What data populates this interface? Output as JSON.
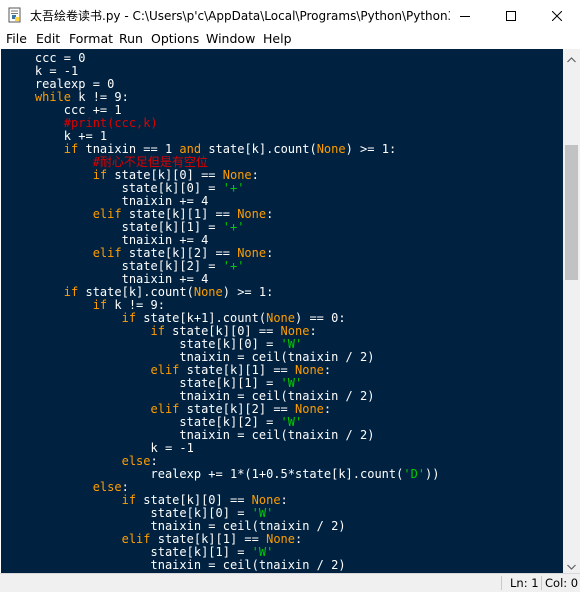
{
  "window": {
    "title": "太吾绘卷读书.py - C:\\Users\\p'c\\AppData\\Local\\Programs\\Python\\Python3...",
    "app_icon": "python-file-icon",
    "controls": [
      "minimize-icon",
      "maximize-icon",
      "close-icon"
    ]
  },
  "menu": [
    {
      "underline": "F",
      "rest": "ile"
    },
    {
      "underline": "E",
      "rest": "dit"
    },
    {
      "underline": "",
      "rest": "Format",
      "pre": "F",
      "prefix_ul": false
    },
    {
      "underline": "R",
      "rest": "un"
    },
    {
      "underline": "O",
      "rest": "ptions"
    },
    {
      "underline": "W",
      "rest": "indow"
    },
    {
      "underline": "H",
      "rest": "elp"
    }
  ],
  "menu_labels": [
    "File",
    "Edit",
    "Format",
    "Run",
    "Options",
    "Window",
    "Help"
  ],
  "colors": {
    "editor_bg": "#002240",
    "keyword": "#ff9d00",
    "comment": "#dd0000",
    "string": "#00cc00",
    "builtin": "#aa66ff",
    "default": "#ffffff"
  },
  "code_lines": [
    [
      {
        "t": "    ccc = 0"
      }
    ],
    [
      {
        "t": "    k = -1"
      }
    ],
    [
      {
        "t": "    realexp = 0"
      }
    ],
    [
      {
        "t": "    "
      },
      {
        "t": "while",
        "c": "kw"
      },
      {
        "t": " k != 9:"
      }
    ],
    [
      {
        "t": "        ccc += 1"
      }
    ],
    [
      {
        "t": "        "
      },
      {
        "t": "#print(ccc,k)",
        "c": "com"
      }
    ],
    [
      {
        "t": "        k += 1"
      }
    ],
    [
      {
        "t": "        "
      },
      {
        "t": "if",
        "c": "kw"
      },
      {
        "t": " tnaixin == 1 "
      },
      {
        "t": "and",
        "c": "kw"
      },
      {
        "t": " state[k].count("
      },
      {
        "t": "None",
        "c": "kw"
      },
      {
        "t": ") >= 1:"
      }
    ],
    [
      {
        "t": "            "
      },
      {
        "t": "#耐心不足但是有空位",
        "c": "com"
      }
    ],
    [
      {
        "t": "            "
      },
      {
        "t": "if",
        "c": "kw"
      },
      {
        "t": " state[k][0] == "
      },
      {
        "t": "None",
        "c": "kw"
      },
      {
        "t": ":"
      }
    ],
    [
      {
        "t": "                state[k][0] = "
      },
      {
        "t": "'+'",
        "c": "str"
      }
    ],
    [
      {
        "t": "                tnaixin += 4"
      }
    ],
    [
      {
        "t": "            "
      },
      {
        "t": "elif",
        "c": "kw"
      },
      {
        "t": " state[k][1] == "
      },
      {
        "t": "None",
        "c": "kw"
      },
      {
        "t": ":"
      }
    ],
    [
      {
        "t": "                state[k][1] = "
      },
      {
        "t": "'+'",
        "c": "str"
      }
    ],
    [
      {
        "t": "                tnaixin += 4"
      }
    ],
    [
      {
        "t": "            "
      },
      {
        "t": "elif",
        "c": "kw"
      },
      {
        "t": " state[k][2] == "
      },
      {
        "t": "None",
        "c": "kw"
      },
      {
        "t": ":"
      }
    ],
    [
      {
        "t": "                state[k][2] = "
      },
      {
        "t": "'+'",
        "c": "str"
      }
    ],
    [
      {
        "t": "                tnaixin += 4"
      }
    ],
    [
      {
        "t": "        "
      },
      {
        "t": "if",
        "c": "kw"
      },
      {
        "t": " state[k].count("
      },
      {
        "t": "None",
        "c": "kw"
      },
      {
        "t": ") >= 1:"
      }
    ],
    [
      {
        "t": "            "
      },
      {
        "t": "if",
        "c": "kw"
      },
      {
        "t": " k != 9:"
      }
    ],
    [
      {
        "t": "                "
      },
      {
        "t": "if",
        "c": "kw"
      },
      {
        "t": " state[k+1].count("
      },
      {
        "t": "None",
        "c": "kw"
      },
      {
        "t": ") == 0:"
      }
    ],
    [
      {
        "t": "                    "
      },
      {
        "t": "if",
        "c": "kw"
      },
      {
        "t": " state[k][0] == "
      },
      {
        "t": "None",
        "c": "kw"
      },
      {
        "t": ":"
      }
    ],
    [
      {
        "t": "                        state[k][0] = "
      },
      {
        "t": "'W'",
        "c": "str"
      }
    ],
    [
      {
        "t": "                        tnaixin = ceil(tnaixin / 2)"
      }
    ],
    [
      {
        "t": "                    "
      },
      {
        "t": "elif",
        "c": "kw"
      },
      {
        "t": " state[k][1] == "
      },
      {
        "t": "None",
        "c": "kw"
      },
      {
        "t": ":"
      }
    ],
    [
      {
        "t": "                        state[k][1] = "
      },
      {
        "t": "'W'",
        "c": "str"
      }
    ],
    [
      {
        "t": "                        tnaixin = ceil(tnaixin / 2)"
      }
    ],
    [
      {
        "t": "                    "
      },
      {
        "t": "elif",
        "c": "kw"
      },
      {
        "t": " state[k][2] == "
      },
      {
        "t": "None",
        "c": "kw"
      },
      {
        "t": ":"
      }
    ],
    [
      {
        "t": "                        state[k][2] = "
      },
      {
        "t": "'W'",
        "c": "str"
      }
    ],
    [
      {
        "t": "                        tnaixin = ceil(tnaixin / 2)"
      }
    ],
    [
      {
        "t": "                    k = -1"
      }
    ],
    [
      {
        "t": "                "
      },
      {
        "t": "else",
        "c": "kw"
      },
      {
        "t": ":"
      }
    ],
    [
      {
        "t": "                    realexp += 1*(1+0.5*state[k].count("
      },
      {
        "t": "'D'",
        "c": "str"
      },
      {
        "t": "))"
      }
    ],
    [
      {
        "t": "            "
      },
      {
        "t": "else",
        "c": "kw"
      },
      {
        "t": ":"
      }
    ],
    [
      {
        "t": "                "
      },
      {
        "t": "if",
        "c": "kw"
      },
      {
        "t": " state[k][0] == "
      },
      {
        "t": "None",
        "c": "kw"
      },
      {
        "t": ":"
      }
    ],
    [
      {
        "t": "                    state[k][0] = "
      },
      {
        "t": "'W'",
        "c": "str"
      }
    ],
    [
      {
        "t": "                    tnaixin = ceil(tnaixin / 2)"
      }
    ],
    [
      {
        "t": "                "
      },
      {
        "t": "elif",
        "c": "kw"
      },
      {
        "t": " state[k][1] == "
      },
      {
        "t": "None",
        "c": "kw"
      },
      {
        "t": ":"
      }
    ],
    [
      {
        "t": "                    state[k][1] = "
      },
      {
        "t": "'W'",
        "c": "str"
      }
    ],
    [
      {
        "t": "                    tnaixin = ceil(tnaixin / 2)"
      }
    ]
  ],
  "status": {
    "line": "Ln: 1",
    "col": "Col: 0"
  }
}
